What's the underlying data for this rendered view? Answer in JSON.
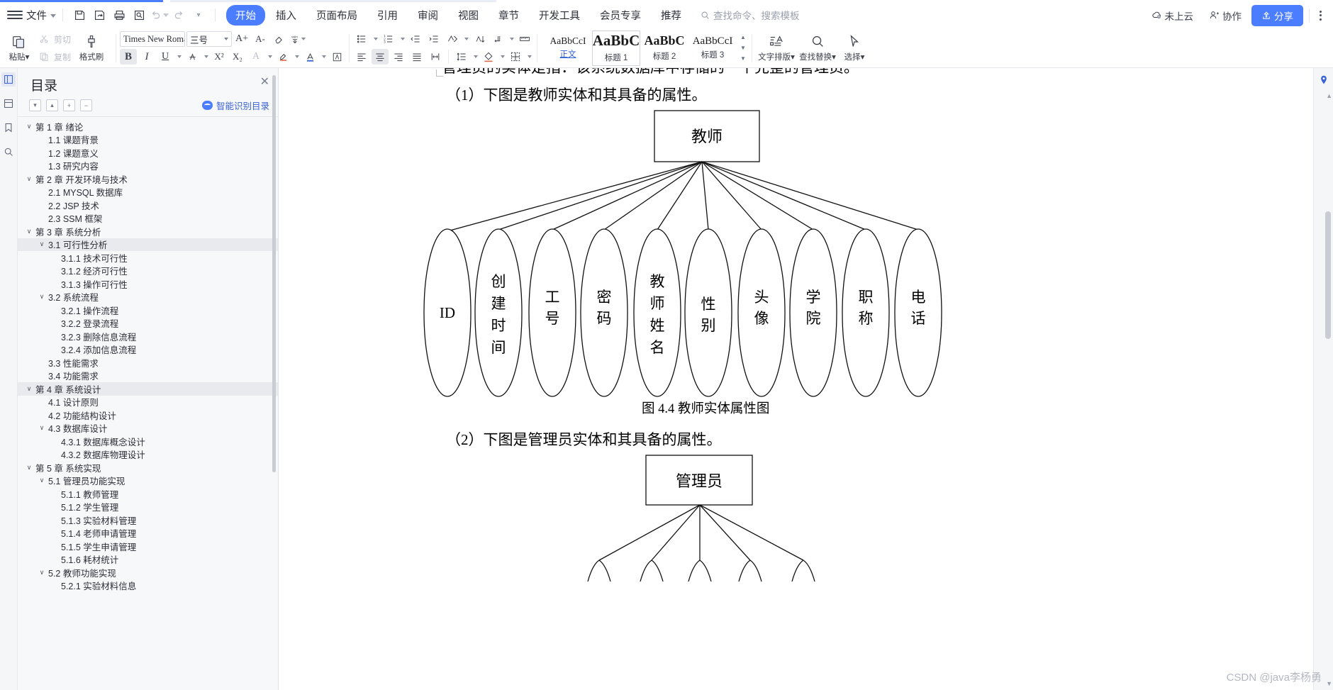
{
  "menubar": {
    "file_label": "文件",
    "quick_icons": [
      "save-icon",
      "save-as-cloud-icon",
      "print-icon",
      "print-preview-icon",
      "undo-icon",
      "redo-icon",
      "customize-icon"
    ],
    "tabs": [
      {
        "label": "开始",
        "active": true
      },
      {
        "label": "插入",
        "active": false
      },
      {
        "label": "页面布局",
        "active": false
      },
      {
        "label": "引用",
        "active": false
      },
      {
        "label": "审阅",
        "active": false
      },
      {
        "label": "视图",
        "active": false
      },
      {
        "label": "章节",
        "active": false
      },
      {
        "label": "开发工具",
        "active": false
      },
      {
        "label": "会员专享",
        "active": false
      },
      {
        "label": "推荐",
        "active": false
      }
    ],
    "search_placeholder": "查找命令、搜索模板",
    "cloud_status": "未上云",
    "collab_label": "协作",
    "share_label": "分享"
  },
  "ribbon": {
    "paste_label": "粘贴",
    "cut_label": "剪切",
    "copy_label": "复制",
    "format_painter_label": "格式刷",
    "font_name": "Times New Roma",
    "font_size": "三号",
    "grow_font": "A+",
    "shrink_font": "A-",
    "bold": "B",
    "italic": "I",
    "underline": "U",
    "text_typesetting_label": "文字排版",
    "find_replace_label": "查找替换",
    "select_label": "选择",
    "styles": [
      {
        "sample": "AaBbCcI",
        "name": "正文",
        "selected": false
      },
      {
        "sample": "AaBbC",
        "name": "标题 1",
        "selected": true
      },
      {
        "sample": "AaBbC",
        "name": "标题 2",
        "selected": false
      },
      {
        "sample": "AaBbCcI",
        "name": "标题 3",
        "selected": false
      }
    ]
  },
  "nav_pane": {
    "title": "目录",
    "close_icon": "close-icon",
    "tool_buttons": [
      "expand-down-icon",
      "collapse-up-icon",
      "expand-all-icon",
      "collapse-all-icon"
    ],
    "smart_toc_label": "智能识别目录",
    "items": [
      {
        "label": "第 1 章 绪论",
        "level": 0,
        "chevron": true,
        "highlight": false
      },
      {
        "label": "1.1 课题背景",
        "level": 1,
        "chevron": false,
        "highlight": false
      },
      {
        "label": "1.2 课题意义",
        "level": 1,
        "chevron": false,
        "highlight": false
      },
      {
        "label": "1.3 研究内容",
        "level": 1,
        "chevron": false,
        "highlight": false
      },
      {
        "label": "第 2 章 开发环境与技术",
        "level": 0,
        "chevron": true,
        "highlight": false
      },
      {
        "label": "2.1 MYSQL 数据库",
        "level": 1,
        "chevron": false,
        "highlight": false
      },
      {
        "label": "2.2 JSP 技术",
        "level": 1,
        "chevron": false,
        "highlight": false
      },
      {
        "label": "2.3 SSM 框架",
        "level": 1,
        "chevron": false,
        "highlight": false
      },
      {
        "label": "第 3 章 系统分析",
        "level": 0,
        "chevron": true,
        "highlight": false
      },
      {
        "label": "3.1 可行性分析",
        "level": 1,
        "chevron": true,
        "highlight": true
      },
      {
        "label": "3.1.1 技术可行性",
        "level": 2,
        "chevron": false,
        "highlight": false
      },
      {
        "label": "3.1.2 经济可行性",
        "level": 2,
        "chevron": false,
        "highlight": false
      },
      {
        "label": "3.1.3 操作可行性",
        "level": 2,
        "chevron": false,
        "highlight": false
      },
      {
        "label": "3.2 系统流程",
        "level": 1,
        "chevron": true,
        "highlight": false
      },
      {
        "label": "3.2.1 操作流程",
        "level": 2,
        "chevron": false,
        "highlight": false
      },
      {
        "label": "3.2.2 登录流程",
        "level": 2,
        "chevron": false,
        "highlight": false
      },
      {
        "label": "3.2.3 删除信息流程",
        "level": 2,
        "chevron": false,
        "highlight": false
      },
      {
        "label": "3.2.4 添加信息流程",
        "level": 2,
        "chevron": false,
        "highlight": false
      },
      {
        "label": "3.3 性能需求",
        "level": 1,
        "chevron": false,
        "highlight": false
      },
      {
        "label": "3.4 功能需求",
        "level": 1,
        "chevron": false,
        "highlight": false
      },
      {
        "label": "第 4 章 系统设计",
        "level": 0,
        "chevron": true,
        "highlight": true
      },
      {
        "label": "4.1 设计原则",
        "level": 1,
        "chevron": false,
        "highlight": false
      },
      {
        "label": "4.2 功能结构设计",
        "level": 1,
        "chevron": false,
        "highlight": false
      },
      {
        "label": "4.3 数据库设计",
        "level": 1,
        "chevron": true,
        "highlight": false
      },
      {
        "label": "4.3.1 数据库概念设计",
        "level": 2,
        "chevron": false,
        "highlight": false
      },
      {
        "label": "4.3.2 数据库物理设计",
        "level": 2,
        "chevron": false,
        "highlight": false
      },
      {
        "label": "第 5 章 系统实现",
        "level": 0,
        "chevron": true,
        "highlight": false
      },
      {
        "label": "5.1 管理员功能实现",
        "level": 1,
        "chevron": true,
        "highlight": false
      },
      {
        "label": "5.1.1 教师管理",
        "level": 2,
        "chevron": false,
        "highlight": false
      },
      {
        "label": "5.1.2 学生管理",
        "level": 2,
        "chevron": false,
        "highlight": false
      },
      {
        "label": "5.1.3 实验材料管理",
        "level": 2,
        "chevron": false,
        "highlight": false
      },
      {
        "label": "5.1.4 老师申请管理",
        "level": 2,
        "chevron": false,
        "highlight": false
      },
      {
        "label": "5.1.5 学生申请管理",
        "level": 2,
        "chevron": false,
        "highlight": false
      },
      {
        "label": "5.1.6 耗材统计",
        "level": 2,
        "chevron": false,
        "highlight": false
      },
      {
        "label": "5.2 教师功能实现",
        "level": 1,
        "chevron": true,
        "highlight": false
      },
      {
        "label": "5.2.1 实验材料信息",
        "level": 2,
        "chevron": false,
        "highlight": false
      }
    ]
  },
  "document": {
    "cut_line_top": "管理员的实体是指：该系统数据库中存储的一个完整的管理员。",
    "paragraph_1": "（1）下图是教师实体和其具备的属性。",
    "figure_caption": "图 4.4  教师实体属性图",
    "paragraph_2": "（2）下图是管理员实体和其具备的属性。",
    "er_diagram_1": {
      "entity": "教师",
      "attributes": [
        "ID",
        "创建时间",
        "工号",
        "密码",
        "教师姓名",
        "性别",
        "头像",
        "学院",
        "职称",
        "电话"
      ]
    },
    "er_diagram_2": {
      "entity": "管理员",
      "attributes": []
    }
  },
  "watermark": "CSDN @java李杨勇"
}
